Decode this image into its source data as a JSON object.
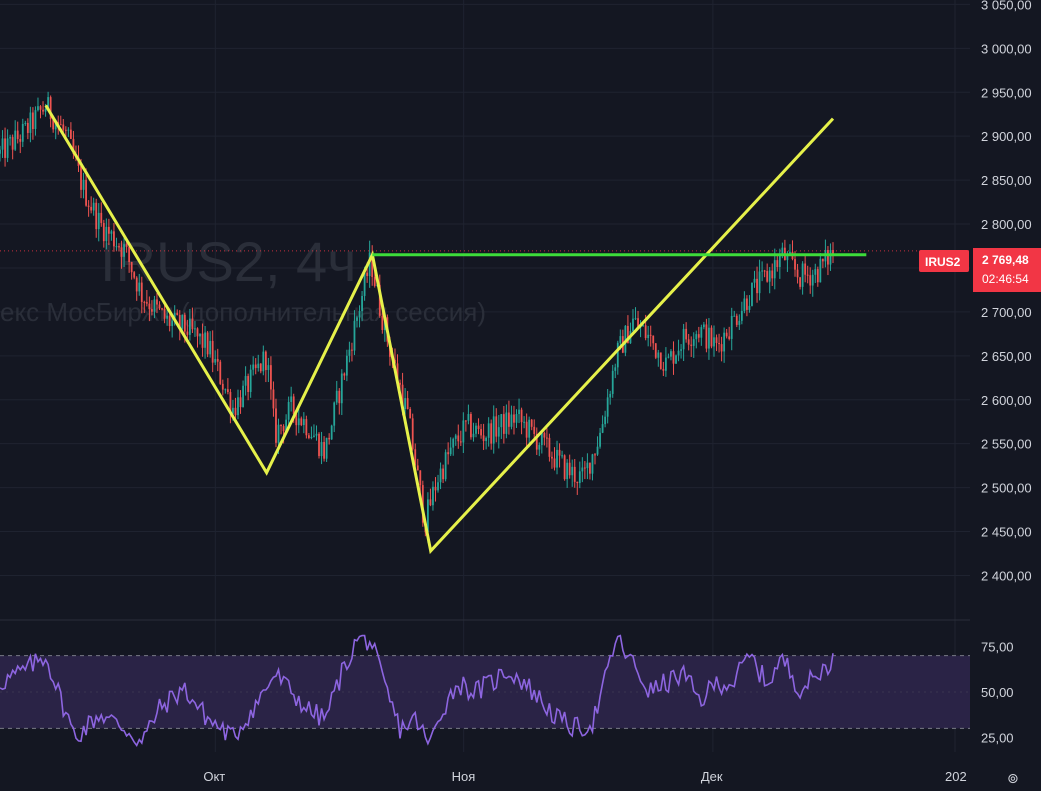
{
  "colors": {
    "background": "#141722",
    "grid": "#1f2330",
    "text": "#d1d4dc",
    "up": "#26a69a",
    "down": "#ef5350",
    "pattern_line": "#e6f14a",
    "resistance_line": "#3ddc3a",
    "rsi_line": "#8d65e0",
    "rsi_band": "#2a2346",
    "price_badge": "#f23645",
    "watermark": "#2a2e39"
  },
  "watermark": {
    "title": "IRUS2, 4ч",
    "subtitle": "екс МосБиржи (дополнительная сессия)"
  },
  "price_badge": {
    "symbol": "IRUS2",
    "price": "2 769,48",
    "countdown": "02:46:54"
  },
  "scroll_icon": "⊚",
  "chart_data": {
    "type": "candlestick",
    "title": "IRUS2, 4ч",
    "price_axis": {
      "ylim": [
        2355,
        3055
      ],
      "ticks": [
        {
          "value": 3050,
          "label": "3 050,00"
        },
        {
          "value": 3000,
          "label": "3 000,00"
        },
        {
          "value": 2950,
          "label": "2 950,00"
        },
        {
          "value": 2900,
          "label": "2 900,00"
        },
        {
          "value": 2850,
          "label": "2 850,00"
        },
        {
          "value": 2800,
          "label": "2 800,00"
        },
        {
          "value": 2750,
          "label": "2 750,00"
        },
        {
          "value": 2700,
          "label": "2 700,00"
        },
        {
          "value": 2650,
          "label": "2 650,00"
        },
        {
          "value": 2600,
          "label": "2 600,00"
        },
        {
          "value": 2550,
          "label": "2 550,00"
        },
        {
          "value": 2500,
          "label": "2 500,00"
        },
        {
          "value": 2450,
          "label": "2 450,00"
        },
        {
          "value": 2400,
          "label": "2 400,00"
        }
      ]
    },
    "time_axis": {
      "labels": [
        {
          "label": "Окт",
          "t": 0.235
        },
        {
          "label": "Ноя",
          "t": 0.506
        },
        {
          "label": "Дек",
          "t": 0.778
        },
        {
          "label": "202",
          "t": 1.0
        }
      ]
    },
    "price_path": [
      [
        0.0,
        2880
      ],
      [
        0.03,
        2905
      ],
      [
        0.055,
        2935
      ],
      [
        0.08,
        2900
      ],
      [
        0.1,
        2840
      ],
      [
        0.12,
        2800
      ],
      [
        0.15,
        2770
      ],
      [
        0.17,
        2720
      ],
      [
        0.2,
        2690
      ],
      [
        0.225,
        2680
      ],
      [
        0.25,
        2660
      ],
      [
        0.28,
        2590
      ],
      [
        0.3,
        2620
      ],
      [
        0.32,
        2650
      ],
      [
        0.33,
        2560
      ],
      [
        0.35,
        2590
      ],
      [
        0.37,
        2570
      ],
      [
        0.39,
        2540
      ],
      [
        0.41,
        2620
      ],
      [
        0.43,
        2700
      ],
      [
        0.445,
        2760
      ],
      [
        0.455,
        2710
      ],
      [
        0.47,
        2650
      ],
      [
        0.49,
        2580
      ],
      [
        0.51,
        2460
      ],
      [
        0.525,
        2510
      ],
      [
        0.54,
        2540
      ],
      [
        0.56,
        2570
      ],
      [
        0.58,
        2560
      ],
      [
        0.6,
        2570
      ],
      [
        0.62,
        2580
      ],
      [
        0.64,
        2560
      ],
      [
        0.66,
        2540
      ],
      [
        0.68,
        2520
      ],
      [
        0.7,
        2510
      ],
      [
        0.72,
        2560
      ],
      [
        0.74,
        2650
      ],
      [
        0.76,
        2690
      ],
      [
        0.78,
        2670
      ],
      [
        0.8,
        2640
      ],
      [
        0.82,
        2670
      ],
      [
        0.84,
        2680
      ],
      [
        0.86,
        2660
      ],
      [
        0.88,
        2690
      ],
      [
        0.9,
        2720
      ],
      [
        0.92,
        2740
      ],
      [
        0.94,
        2765
      ],
      [
        0.96,
        2740
      ],
      [
        0.98,
        2745
      ],
      [
        1.0,
        2769
      ]
    ],
    "current_price": 2769.48,
    "pattern_lines": [
      {
        "name": "zigzag",
        "points": [
          [
            0.055,
            2935
          ],
          [
            0.32,
            2517
          ],
          [
            0.447,
            2765
          ],
          [
            0.517,
            2428
          ],
          [
            1.0,
            2920
          ]
        ]
      }
    ],
    "resistance_line": {
      "value": 2765,
      "from": 0.447,
      "to": 1.04
    },
    "rsi": {
      "ylim": [
        17,
        83
      ],
      "ticks": [
        {
          "value": 75,
          "label": "75,00"
        },
        {
          "value": 50,
          "label": "50,00"
        },
        {
          "value": 25,
          "label": "25,00"
        }
      ],
      "band": [
        30,
        70
      ],
      "path": [
        [
          0.0,
          55
        ],
        [
          0.03,
          62
        ],
        [
          0.055,
          70
        ],
        [
          0.07,
          50
        ],
        [
          0.09,
          25
        ],
        [
          0.12,
          38
        ],
        [
          0.15,
          30
        ],
        [
          0.17,
          22
        ],
        [
          0.19,
          40
        ],
        [
          0.22,
          52
        ],
        [
          0.25,
          35
        ],
        [
          0.28,
          25
        ],
        [
          0.31,
          45
        ],
        [
          0.33,
          60
        ],
        [
          0.35,
          50
        ],
        [
          0.37,
          40
        ],
        [
          0.39,
          35
        ],
        [
          0.41,
          60
        ],
        [
          0.43,
          80
        ],
        [
          0.445,
          78
        ],
        [
          0.46,
          55
        ],
        [
          0.48,
          30
        ],
        [
          0.5,
          35
        ],
        [
          0.515,
          20
        ],
        [
          0.53,
          40
        ],
        [
          0.55,
          55
        ],
        [
          0.57,
          50
        ],
        [
          0.59,
          55
        ],
        [
          0.61,
          62
        ],
        [
          0.63,
          55
        ],
        [
          0.65,
          45
        ],
        [
          0.67,
          35
        ],
        [
          0.69,
          30
        ],
        [
          0.71,
          32
        ],
        [
          0.72,
          45
        ],
        [
          0.74,
          80
        ],
        [
          0.76,
          65
        ],
        [
          0.78,
          50
        ],
        [
          0.8,
          55
        ],
        [
          0.82,
          60
        ],
        [
          0.84,
          45
        ],
        [
          0.86,
          55
        ],
        [
          0.88,
          55
        ],
        [
          0.9,
          70
        ],
        [
          0.92,
          55
        ],
        [
          0.94,
          68
        ],
        [
          0.96,
          52
        ],
        [
          0.98,
          58
        ],
        [
          1.0,
          69
        ]
      ]
    }
  }
}
